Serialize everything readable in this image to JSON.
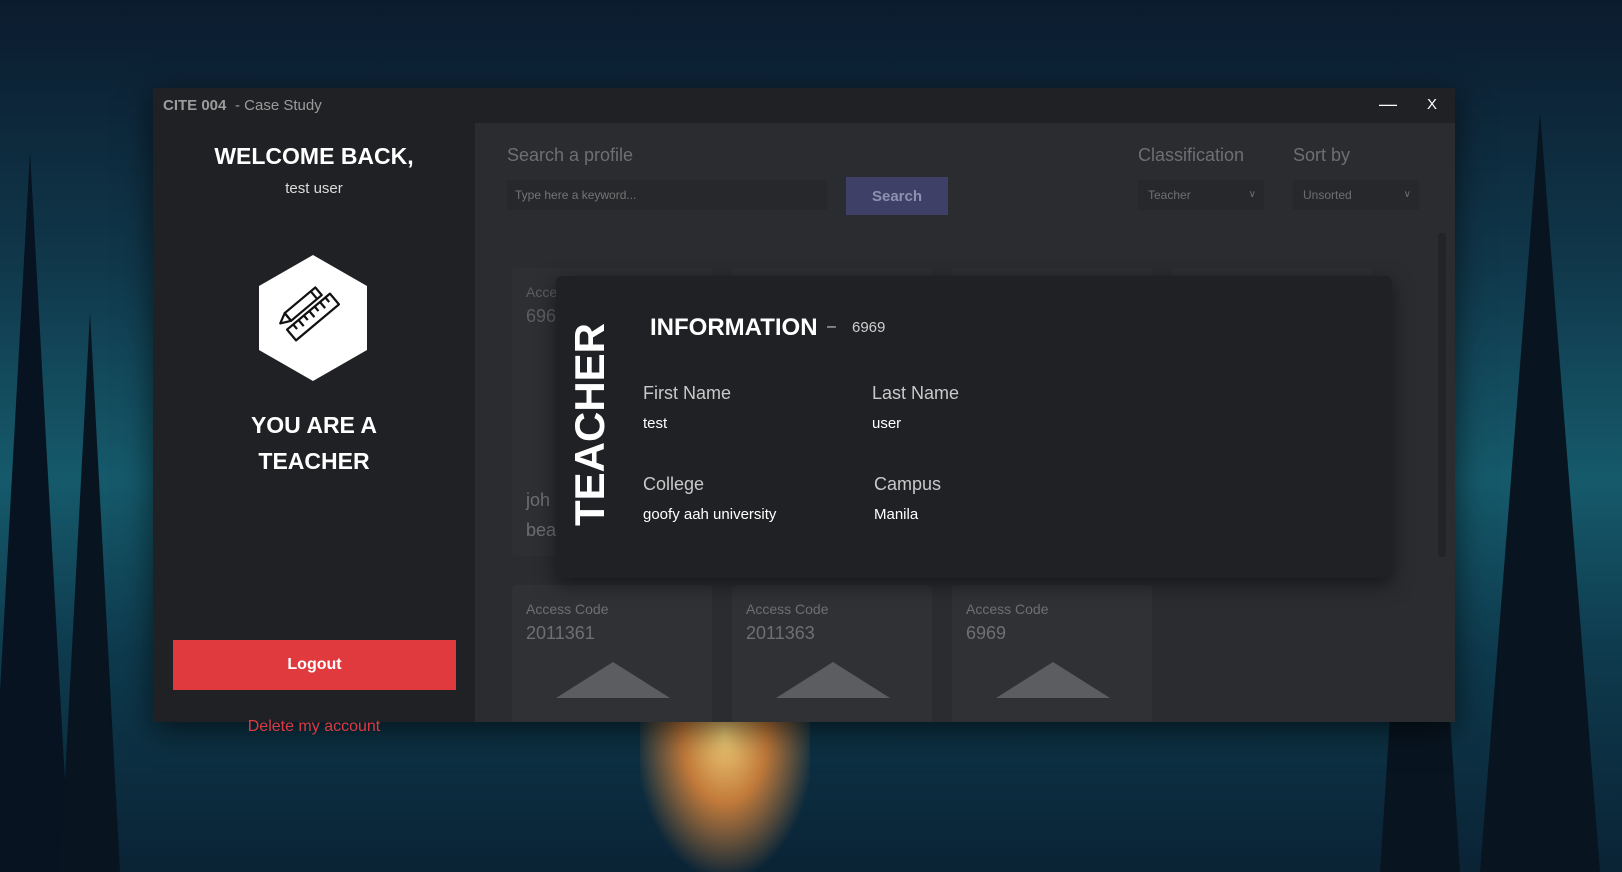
{
  "window": {
    "app_name": "CITE 004",
    "subtitle": "- Case Study",
    "minimize_label": "—",
    "close_label": "X"
  },
  "sidebar": {
    "welcome": "WELCOME BACK,",
    "username": "test user",
    "role_icon": "pencil-ruler-icon",
    "role_line1": "YOU ARE A",
    "role_line2": "TEACHER",
    "logout_label": "Logout",
    "delete_label": "Delete my account"
  },
  "search": {
    "label": "Search a profile",
    "placeholder": "Type here a keyword...",
    "button_label": "Search"
  },
  "filters": {
    "classification_label": "Classification",
    "classification_value": "Teacher",
    "sort_label": "Sort by",
    "sort_value": "Unsorted"
  },
  "cards_top": [
    {
      "access_label": "Acce",
      "code": "696",
      "name1": "joh",
      "name2": "bea"
    }
  ],
  "cards_bottom": [
    {
      "access_label": "Access Code",
      "code": "2011361"
    },
    {
      "access_label": "Access Code",
      "code": "2011363"
    },
    {
      "access_label": "Access Code",
      "code": "6969"
    }
  ],
  "modal": {
    "role_vertical": "TEACHER",
    "title": "INFORMATION",
    "dash": "–",
    "id": "6969",
    "first_name_label": "First Name",
    "first_name": "test",
    "last_name_label": "Last Name",
    "last_name": "user",
    "college_label": "College",
    "college": "goofy aah university",
    "campus_label": "Campus",
    "campus": "Manila"
  },
  "colors": {
    "accent_red": "#e0393e",
    "search_button": "#3e4068",
    "sidebar_bg": "#202124",
    "main_bg": "#2b2c30"
  }
}
